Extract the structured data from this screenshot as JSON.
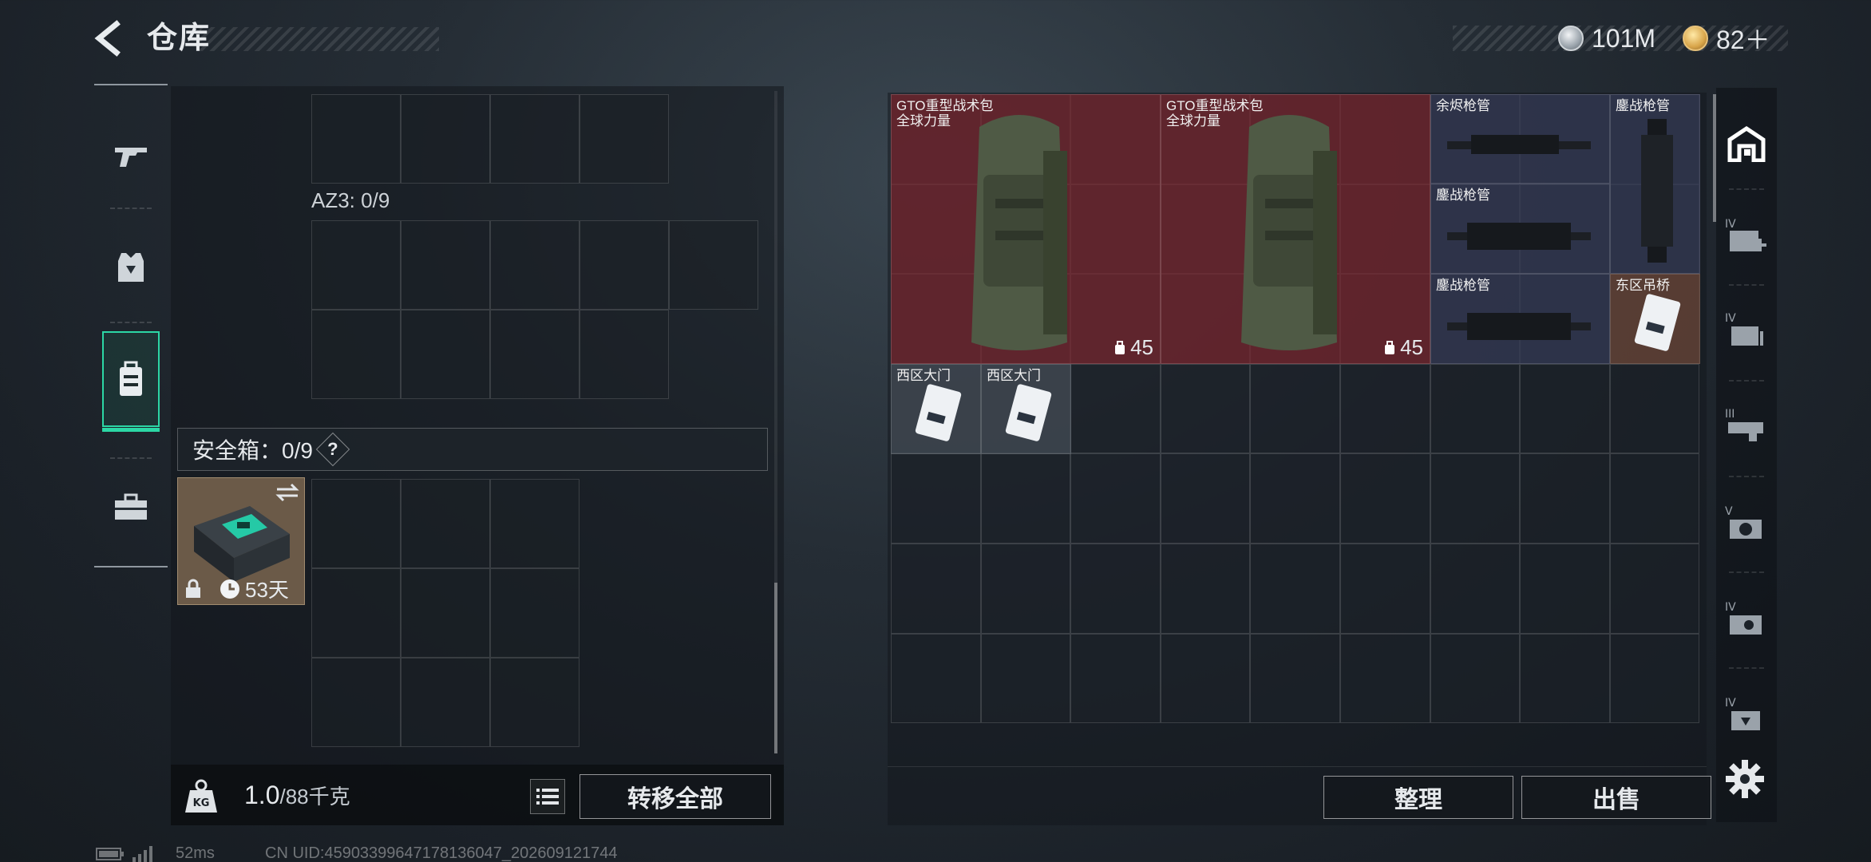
{
  "header": {
    "title": "仓库"
  },
  "currency": {
    "silver": "101M",
    "gold": "82＋"
  },
  "left_nav": [
    "weapon-icon",
    "vest-icon",
    "backpack-icon",
    "toolbox-icon"
  ],
  "az3_label": "AZ3: 0/9",
  "safe_box": {
    "label": "安全箱：0/9",
    "help": "?",
    "days": "53天"
  },
  "weight": {
    "current": "1.0",
    "max": "/88千克"
  },
  "buttons": {
    "transfer_all": "转移全部",
    "sort": "整理",
    "sell": "出售"
  },
  "stash_items": [
    {
      "name": "GTO重型战术包\n全球力量",
      "count": "45",
      "color": "red"
    },
    {
      "name": "GTO重型战术包\n全球力量",
      "count": "45",
      "color": "red"
    },
    {
      "name": "余烬枪管",
      "color": "blue"
    },
    {
      "name": "鏖战枪管",
      "color": "blue"
    },
    {
      "name": "鏖战枪管",
      "color": "blue"
    },
    {
      "name": "鏖战枪管",
      "color": "blue"
    },
    {
      "name": "东区吊桥",
      "color": "brown"
    },
    {
      "name": "西区大门",
      "color": "grey"
    },
    {
      "name": "西区大门",
      "color": "grey"
    }
  ],
  "right_nav": [
    "home-base-icon",
    "medical-icon",
    "container-icon",
    "ammo-icon",
    "camera-icon",
    "gear-case-icon",
    "vest-badge-icon"
  ],
  "status": {
    "ping": "52ms",
    "uid": "CN UID:4590339964717813604​7_202609121744"
  }
}
